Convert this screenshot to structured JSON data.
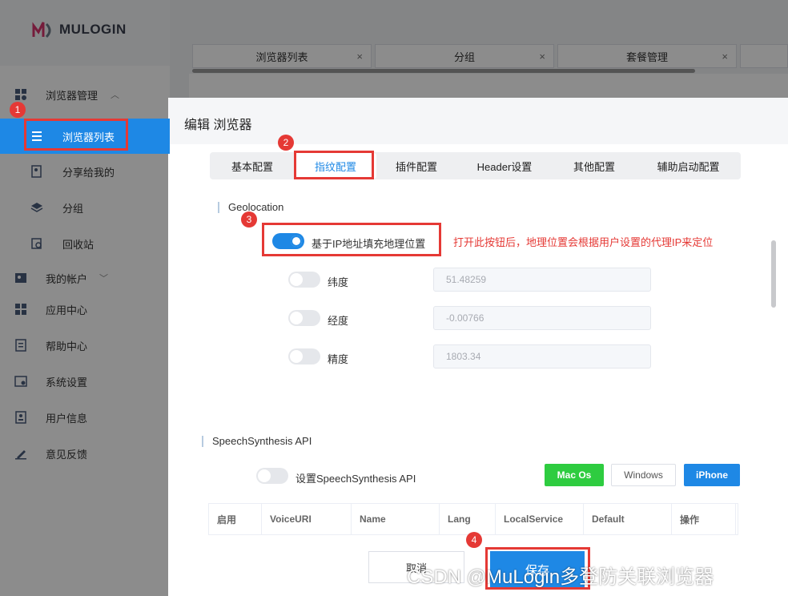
{
  "app": {
    "logo_text": "MULOGIN",
    "sidebar": {
      "browser_mgmt": "浏览器管理",
      "browser_list": "浏览器列表",
      "share_to_me": "分享给我的",
      "group": "分组",
      "recycle": "回收站",
      "my_account": "我的帐户",
      "app_center": "应用中心",
      "help_center": "帮助中心",
      "system_settings": "系统设置",
      "user_info": "用户信息",
      "feedback": "意见反馈"
    },
    "tabs": [
      "浏览器列表",
      "分组",
      "套餐管理"
    ],
    "tab_close": "×"
  },
  "dialog": {
    "title": "编辑 浏览器",
    "tabs": [
      "基本配置",
      "指纹配置",
      "插件配置",
      "Header设置",
      "其他配置",
      "辅助启动配置"
    ],
    "geolocation": {
      "section": "Geolocation",
      "fill_by_ip_label": "基于IP地址填充地理位置",
      "latitude_label": "纬度",
      "latitude_value": "51.48259",
      "longitude_label": "经度",
      "longitude_value": "-0.00766",
      "accuracy_label": "精度",
      "accuracy_value": "1803.34"
    },
    "note": "打开此按钮后，地理位置会根据用户设置的代理IP来定位",
    "speech": {
      "section": "SpeechSynthesis API",
      "toggle_label": "设置SpeechSynthesis API",
      "btn_mac": "Mac Os",
      "btn_windows": "Windows",
      "btn_iphone": "iPhone",
      "columns": [
        "启用",
        "VoiceURI",
        "Name",
        "Lang",
        "LocalService",
        "Default",
        "操作"
      ]
    },
    "cancel": "取消",
    "save": "保存"
  },
  "badges": [
    "1",
    "2",
    "3",
    "4"
  ],
  "watermark": "CSDN @MuLogin多登防关联浏览器"
}
